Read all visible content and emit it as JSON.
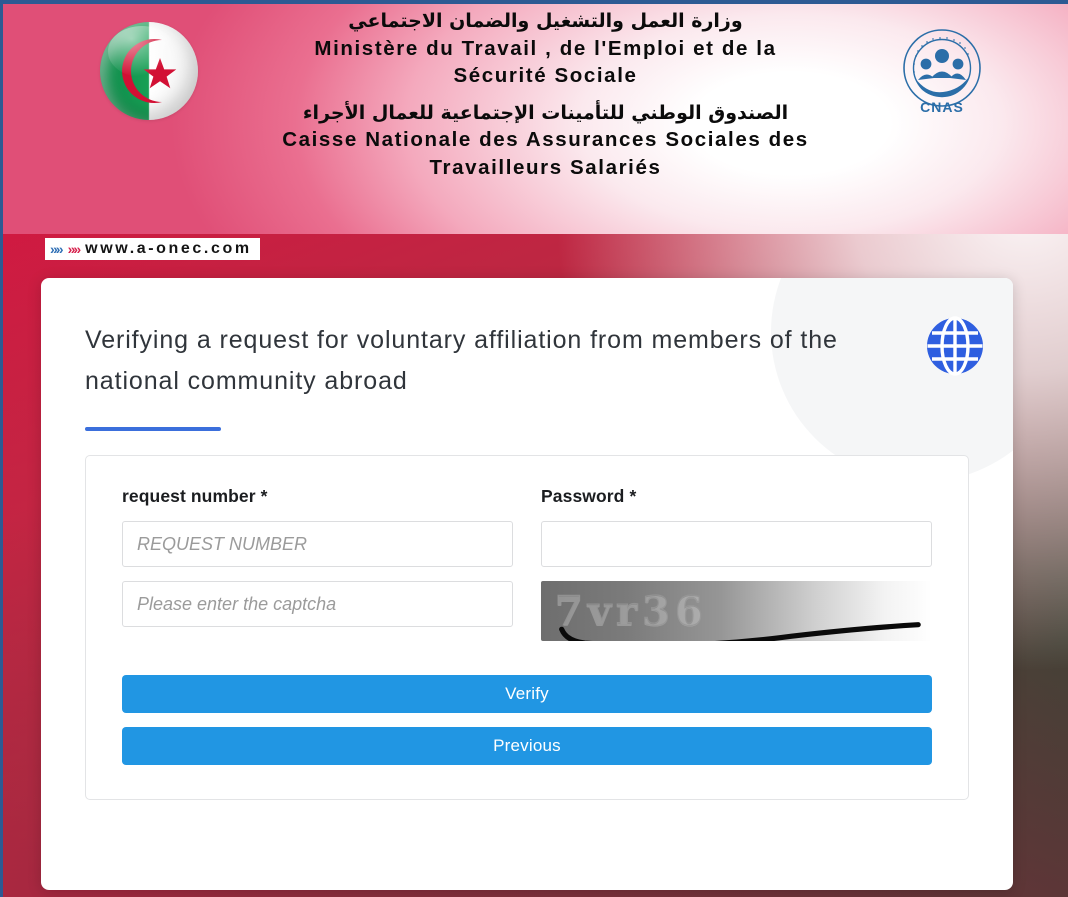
{
  "header": {
    "ministry_ar": "وزارة العمل والتشغيل والضمان الاجتماعي",
    "ministry_fr_line1": "Ministère du Travail , de l'Emploi et de la",
    "ministry_fr_line2": "Sécurité Sociale",
    "fund_ar": "الصندوق الوطني للتأمينات الإجتماعية للعمال الأجراء",
    "fund_fr_line1": "Caisse Nationale des Assurances Sociales des",
    "fund_fr_line2": "Travailleurs Salariés",
    "logo_text": "CNAS",
    "flag_icon": "algeria-flag-icon",
    "logo_icon": "cnas-logo-icon"
  },
  "url_ribbon": {
    "chevrons_blue": "»»",
    "chevrons_red": "»»",
    "url": "www.a-onec.com"
  },
  "card": {
    "title": "Verifying a request for voluntary affiliation from members of the national community abroad",
    "globe_icon": "globe-icon"
  },
  "form": {
    "request_number": {
      "label": "request number",
      "required_mark": "*",
      "placeholder": "REQUEST NUMBER",
      "value": ""
    },
    "password": {
      "label": "Password",
      "required_mark": "*",
      "placeholder": "",
      "value": ""
    },
    "captcha_input": {
      "placeholder": "Please enter the captcha",
      "value": ""
    },
    "captcha_image": {
      "text": "7vr36",
      "alt": "captcha-image"
    }
  },
  "buttons": {
    "verify": "Verify",
    "previous": "Previous"
  },
  "colors": {
    "primary_blue": "#2196e3",
    "accent_rule_blue": "#3b6fdc",
    "brand_red": "#d6204c",
    "chevron_blue": "#2f6fb5",
    "cnas_blue": "#2b6ea8",
    "border_top_blue": "#2d5a93"
  }
}
